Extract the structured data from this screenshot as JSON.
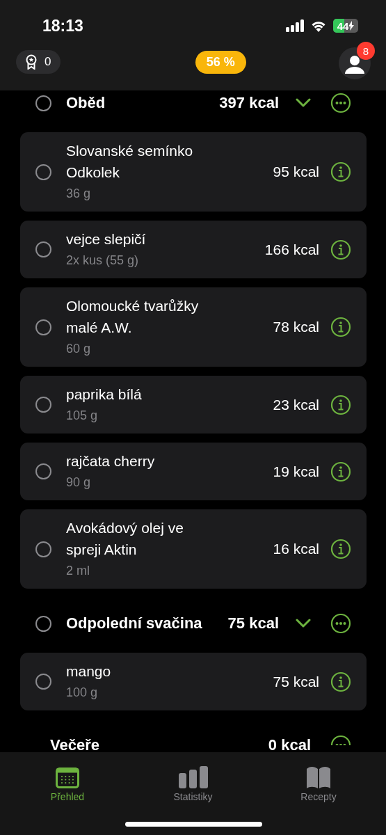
{
  "status_bar": {
    "time": "18:13",
    "battery": "44"
  },
  "header": {
    "awards": "0",
    "progress": "56 %",
    "notifications": "8"
  },
  "sections": [
    {
      "name": "Oběd",
      "kcal": "397 kcal",
      "checked": false,
      "expanded": true,
      "items": [
        {
          "name": "Slovanské semínko Odkolek",
          "amount": "36 g",
          "kcal": "95 kcal",
          "checked": false
        },
        {
          "name": "vejce slepičí",
          "amount": "2x kus (55 g)",
          "kcal": "166 kcal",
          "checked": false
        },
        {
          "name": "Olomoucké tvarůžky malé A.W.",
          "amount": "60 g",
          "kcal": "78 kcal",
          "checked": false
        },
        {
          "name": "paprika bílá",
          "amount": "105 g",
          "kcal": "23 kcal",
          "checked": false
        },
        {
          "name": "rajčata cherry",
          "amount": "90 g",
          "kcal": "19 kcal",
          "checked": false
        },
        {
          "name": "Avokádový olej ve spreji Aktin",
          "amount": "2 ml",
          "kcal": "16 kcal",
          "checked": false
        }
      ]
    },
    {
      "name": "Odpolední svačina",
      "kcal": "75 kcal",
      "checked": false,
      "expanded": true,
      "items": [
        {
          "name": "mango",
          "amount": "100 g",
          "kcal": "75 kcal",
          "checked": false
        }
      ]
    },
    {
      "name": "Večeře",
      "kcal": "0 kcal"
    }
  ],
  "tabs": [
    {
      "label": "Přehled",
      "selected": true,
      "kind": "calendar"
    },
    {
      "label": "Statistiky",
      "selected": false,
      "kind": "stats"
    },
    {
      "label": "Recepty",
      "selected": false,
      "kind": "book"
    }
  ]
}
